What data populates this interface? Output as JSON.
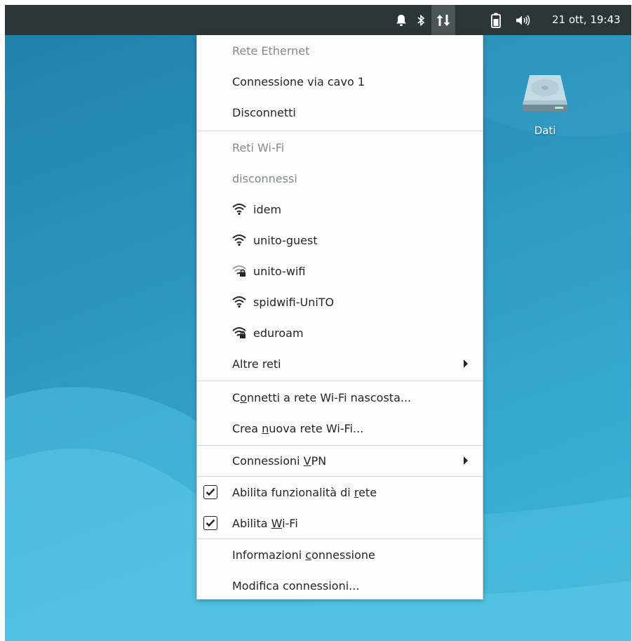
{
  "colors": {
    "panel_bg": "#2c3639",
    "desktop_bg": "#2a93bd",
    "menu_bg": "#fcfcfc",
    "header_text": "#7f8c8d",
    "item_text": "#232627"
  },
  "panel": {
    "tray_icons": [
      "notification-bell-icon",
      "bluetooth-icon",
      "network-transfer-icon",
      "battery-icon",
      "volume-icon"
    ],
    "clock": "21 ott, 19:43"
  },
  "desktop": {
    "icons": [
      {
        "label": "Dati",
        "icon": "hard-drive-icon"
      }
    ]
  },
  "menu": {
    "ethernet_header": "Rete Ethernet",
    "ethernet_connection": "Connessione via cavo 1",
    "disconnect": "Disconnetti",
    "wifi_header": "Reti Wi-Fi",
    "wifi_status": "disconnessi",
    "wifi_networks": [
      {
        "name": "idem",
        "secured": false
      },
      {
        "name": "unito-guest",
        "secured": false
      },
      {
        "name": "unito-wifi",
        "secured": true
      },
      {
        "name": "spidwifi-UniTO",
        "secured": false
      },
      {
        "name": "eduroam",
        "secured": true
      }
    ],
    "other_networks": "Altre reti",
    "connect_hidden": {
      "before": "C",
      "mnemonic": "o",
      "after": "nnetti a rete Wi-Fi nascosta..."
    },
    "create_new": {
      "before": "Crea ",
      "mnemonic": "n",
      "after": "uova rete Wi-Fi..."
    },
    "vpn": {
      "before": "Connessioni ",
      "mnemonic": "V",
      "after": "PN"
    },
    "enable_networking": {
      "before": "Abilita funzionalità di ",
      "mnemonic": "r",
      "after": "ete",
      "checked": true
    },
    "enable_wifi": {
      "before": "Abilita ",
      "mnemonic": "W",
      "after": "i-Fi",
      "checked": true
    },
    "connection_info": {
      "before": "Informazioni ",
      "mnemonic": "c",
      "after": "onnessione"
    },
    "edit_connections": "Modifica connessioni..."
  }
}
